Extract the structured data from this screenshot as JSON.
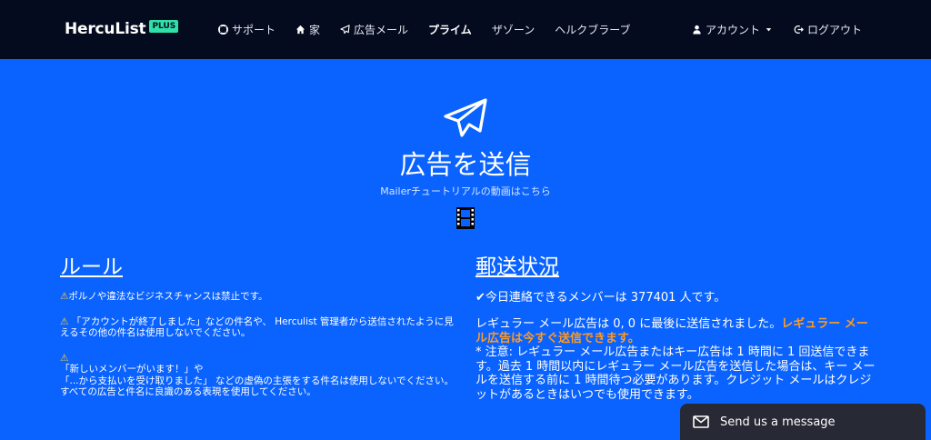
{
  "brand": {
    "name": "HercuList",
    "badge": "PLUS"
  },
  "nav": {
    "items": [
      {
        "label": "サポート",
        "icon": "lifebuoy-icon"
      },
      {
        "label": "家",
        "icon": "home-icon"
      },
      {
        "label": "広告メール",
        "icon": "paper-plane-icon"
      },
      {
        "label": "プライム",
        "icon": ""
      },
      {
        "label": "ザゾーン",
        "icon": ""
      },
      {
        "label": "ヘルクブラーブ",
        "icon": ""
      }
    ],
    "account_label": "アカウント",
    "logout_label": "ログアウト"
  },
  "hero": {
    "title": "広告を送信",
    "subtitle": "Mailerチュートリアルの動画はこちら"
  },
  "rules": {
    "title": "ルール",
    "items": [
      "ポルノや違法なビジネスチャンスは禁止です。",
      "「アカウントが終了しました」などの件名や、 Herculist 管理者から送信されたように見えるその他の件名は使用しないでください。",
      "「新しいメンバーがいます！」や",
      "「...から支払いを受け取りました」 などの虚偽の主張をする件名は使用しないでください。",
      "すべての広告と件名に良識のある表現を使用してください。"
    ]
  },
  "status": {
    "title": "郵送状況",
    "members_line": "今日連絡できるメンバーは 377401 人です。",
    "regular_text": "レギュラー メール広告は 0, 0 に最後に送信されました。",
    "regular_highlight": "レギュラー メール広告は今すぐ送信できます。",
    "note": "* 注意: レギュラー メール広告またはキー広告は 1 時間に 1 回送信できます。過去 1 時間以内にレギュラー メール広告を送信した場合は、キー メールを送信する前に 1 時間待つ必要があります。クレジット メールはクレジットがあるときはいつでも使用できます。"
  },
  "chat": {
    "label": "Send us a message"
  },
  "colors": {
    "background": "#0a63ff",
    "navbar": "#050b1f",
    "badge": "#2fe0a8",
    "highlight": "#ff9b21",
    "warning": "#ffd02b"
  }
}
